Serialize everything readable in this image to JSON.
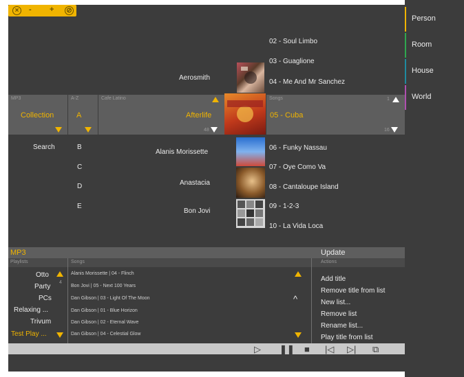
{
  "window": {
    "minimize_label": "-",
    "maximize_label": "+"
  },
  "top_artist": "Aerosmith",
  "top_songs": [
    "02 - Soul Limbo",
    "03 - Guaglione",
    "04 - Me And Mr Sanchez"
  ],
  "browse": {
    "mp3_header": "MP3",
    "az_header": "A-Z",
    "artist_header": "Cafe Latino",
    "songs_header": "Songs",
    "collection": "Collection",
    "letter": "A",
    "artist": "Afterlife",
    "artist_count": "48",
    "song": "05 - Cuba",
    "song_index": "1",
    "song_count": "16"
  },
  "search_label": "Search",
  "letters": [
    "B",
    "C",
    "D",
    "E"
  ],
  "artists_below": [
    "Alanis Morissette",
    "Anastacia",
    "Bon Jovi"
  ],
  "songs_below": [
    "06 - Funky Nassau",
    "07 - Oye Como Va",
    "08 - Cantaloupe Island",
    "09 - 1-2-3",
    "10 - La Vida Loca"
  ],
  "bottom": {
    "title": "MP3",
    "update_label": "Update",
    "playlists_header": "Playlists",
    "songs_header": "Songs",
    "actions_header": "Actions",
    "playlists": [
      "Otto",
      "Party",
      "PCs",
      "Relaxing ...",
      "Trivum",
      "Test Play ..."
    ],
    "party_badge": "4",
    "songs": [
      "Alanis Morissette | 04 - Flinch",
      "Bon Jovi | 05 - Next 100 Years",
      "Dan Gibson | 03 - Light Of The Moon",
      "Dan Gibson | 01 - Blue Horizon",
      "Dan Gibson | 02 - Eternal Wave",
      "Dan Gibson | 04 - Celestial Glow"
    ],
    "actions": [
      "Add title",
      "Remove title from list",
      "New list...",
      "Remove list",
      "Rename list...",
      "Play title from list"
    ],
    "scroll_up_symbol": "^"
  },
  "side_nav": [
    {
      "label": "Person",
      "color": "#f0b400"
    },
    {
      "label": "Room",
      "color": "#2fa84f"
    },
    {
      "label": "House",
      "color": "#1f8aa0"
    },
    {
      "label": "World",
      "color": "#b04fb0"
    }
  ],
  "colors": {
    "accent": "#f0b400",
    "panel": "#3c3c3c",
    "band": "#5e5e5e"
  }
}
